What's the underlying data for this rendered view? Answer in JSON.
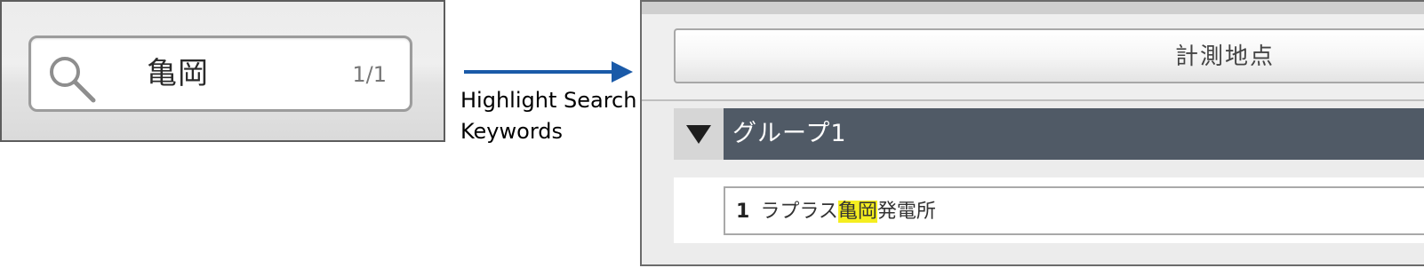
{
  "search": {
    "query": "亀岡",
    "match_count": "1/1",
    "icon": "search-icon"
  },
  "annotation": {
    "caption_line1": "Highlight Search",
    "caption_line2": "Keywords",
    "arrow_color": "#1a5aa8"
  },
  "results": {
    "header_label": "計測地点",
    "group": {
      "toggle_icon": "triangle-down-icon",
      "title": "グループ1"
    },
    "items": [
      {
        "number": "1",
        "text_before": "ラプラス",
        "text_highlight": "亀岡",
        "text_after": "発電所"
      }
    ],
    "highlight_color": "#f5ee1f"
  }
}
